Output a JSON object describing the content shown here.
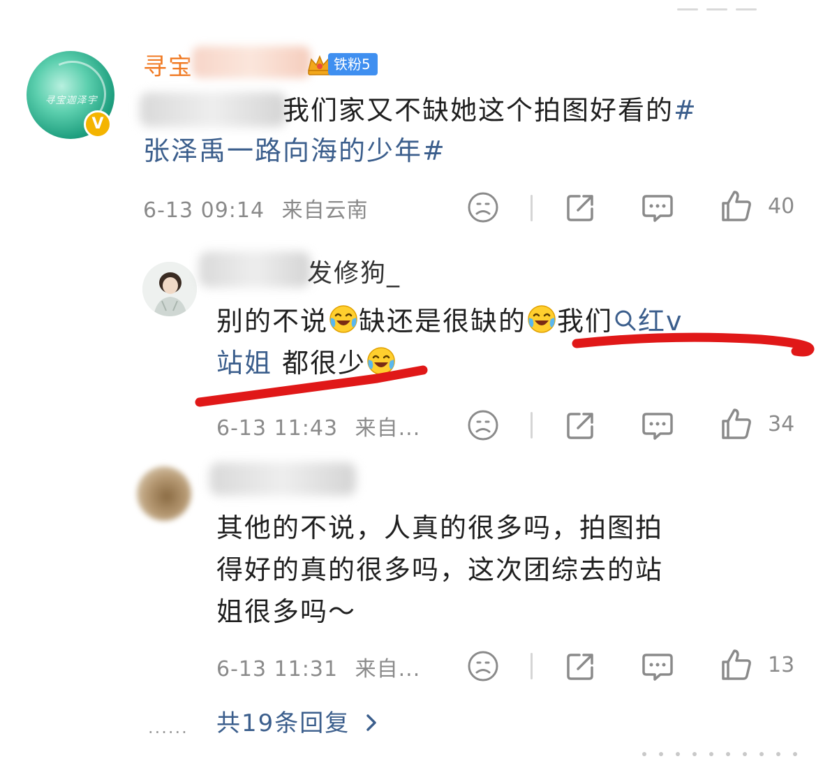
{
  "main_comment": {
    "username": "寻宝",
    "fan_badge": "铁粉5",
    "verified_mark": "V",
    "avatar_text": "寻宝迦泽宇",
    "text_line1": "我们家又不缺她这个拍图好看的",
    "hashtag_start": "#",
    "hashtag_line2": "张泽禹一路向海的少年#",
    "timestamp": "6-13 09:14",
    "location": "来自云南",
    "like_count": "40"
  },
  "reply1": {
    "username": "发修狗_",
    "text_a": "别的不说",
    "text_b": "缺还是很缺的",
    "text_c": "我们",
    "search_label": "红v",
    "search_label2": "站姐",
    "text_d": " 都很少",
    "timestamp": "6-13 11:43",
    "location": "来自...",
    "like_count": "34"
  },
  "reply2": {
    "text_line1": "其他的不说，人真的很多吗，拍图拍",
    "text_line2": "得好的真的很多吗，这次团综去的站",
    "text_line3": "姐很多吗～",
    "timestamp": "6-13 11:31",
    "location": "来自...",
    "like_count": "13"
  },
  "more_replies": {
    "dots": "......",
    "label": "共19条回复"
  },
  "colors": {
    "username_main": "#f07a23",
    "hashtag": "#3b5e8c",
    "fan_badge_bg": "#3f8ff0",
    "annotation_red": "#e01818"
  },
  "icons": [
    "sad-face-icon",
    "share-icon",
    "comment-icon",
    "thumbs-up-icon",
    "search-icon",
    "chevron-right-icon",
    "laughing-cry-emoji"
  ]
}
